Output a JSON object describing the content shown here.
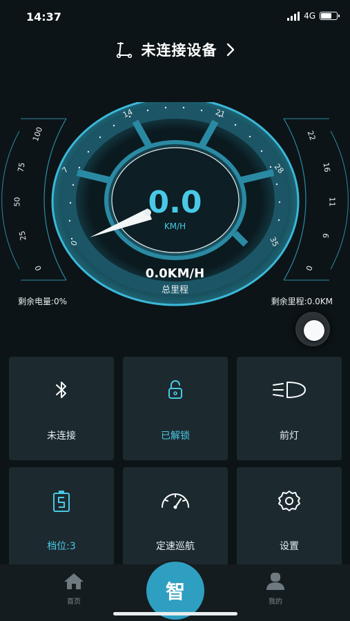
{
  "status_bar": {
    "time": "14:37",
    "network": "4G",
    "battery_level": 0.75
  },
  "header": {
    "title": "未连接设备",
    "scooter_icon": "scooter-icon",
    "chevron_icon": "chevron-right-icon"
  },
  "gauge": {
    "speed": "0.0",
    "unit": "KM/H",
    "scale_ticks": [
      "0",
      "7",
      "14",
      "21",
      "28",
      "35"
    ],
    "left_scale": [
      "100",
      "75",
      "50",
      "25",
      "0"
    ],
    "right_scale": [
      "22",
      "16",
      "11",
      "6",
      "0"
    ]
  },
  "odometer": {
    "value": "0.0KM/H",
    "label": "总里程"
  },
  "remaining": {
    "battery": "剩余电量:0%",
    "range": "剩余里程:0.0KM"
  },
  "tiles": [
    {
      "label": "未连接",
      "icon": "bluetooth-icon"
    },
    {
      "label": "已解锁",
      "icon": "unlock-icon"
    },
    {
      "label": "前灯",
      "icon": "headlight-icon"
    },
    {
      "label": "档位:3",
      "icon": "gear-level-icon"
    },
    {
      "label": "定速巡航",
      "icon": "cruise-control-icon"
    },
    {
      "label": "设置",
      "icon": "settings-icon"
    }
  ],
  "nav": {
    "home": "首页",
    "center": "智",
    "mine": "我的"
  },
  "colors": {
    "accent": "#49c9e6",
    "tile_bg": "#1c2a2f",
    "background": "#0c1417"
  }
}
